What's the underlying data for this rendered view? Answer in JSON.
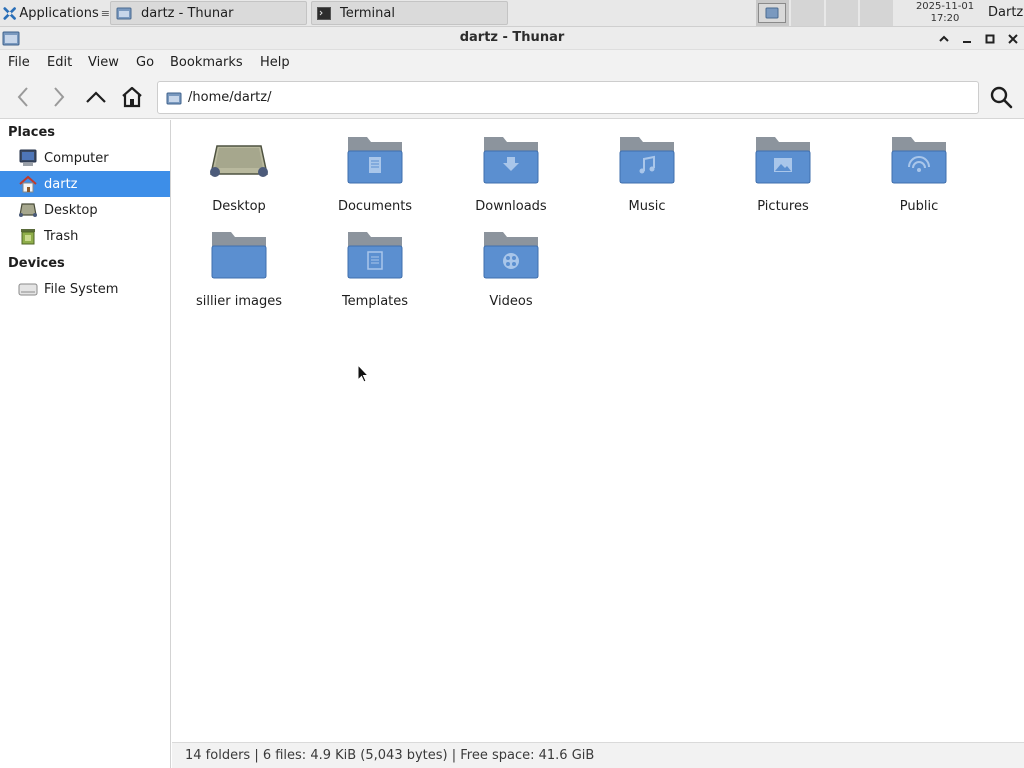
{
  "panel": {
    "applications_label": "Applications",
    "tasks": [
      {
        "label": "dartz - Thunar",
        "icon": "folder-icon"
      },
      {
        "label": "Terminal",
        "icon": "terminal-icon"
      }
    ],
    "clock_date": "2025-11-01",
    "clock_time": "17:20",
    "user": "Dartz"
  },
  "window": {
    "title": "dartz - Thunar"
  },
  "menubar": {
    "file": "File",
    "edit": "Edit",
    "view": "View",
    "go": "Go",
    "bookmarks": "Bookmarks",
    "help": "Help"
  },
  "toolbar": {
    "location": "/home/dartz/"
  },
  "sidebar": {
    "places_header": "Places",
    "devices_header": "Devices",
    "places": [
      {
        "label": "Computer",
        "icon": "computer-icon"
      },
      {
        "label": "dartz",
        "icon": "home-icon",
        "selected": true
      },
      {
        "label": "Desktop",
        "icon": "desktop-icon"
      },
      {
        "label": "Trash",
        "icon": "trash-icon"
      }
    ],
    "devices": [
      {
        "label": "File System",
        "icon": "drive-icon"
      }
    ]
  },
  "files": [
    {
      "label": "Desktop",
      "icon": "desktop-folder-icon"
    },
    {
      "label": "Documents",
      "icon": "documents-folder-icon"
    },
    {
      "label": "Downloads",
      "icon": "downloads-folder-icon"
    },
    {
      "label": "Music",
      "icon": "music-folder-icon"
    },
    {
      "label": "Pictures",
      "icon": "pictures-folder-icon"
    },
    {
      "label": "Public",
      "icon": "public-folder-icon"
    },
    {
      "label": "sillier images",
      "icon": "folder-icon"
    },
    {
      "label": "Templates",
      "icon": "templates-folder-icon"
    },
    {
      "label": "Videos",
      "icon": "videos-folder-icon"
    }
  ],
  "statusbar": {
    "text": "14 folders  |  6 files: 4.9 KiB (5,043 bytes)  |  Free space: 41.6 GiB"
  },
  "colors": {
    "selection": "#3d8ee8",
    "folder_body": "#5b8fd0",
    "folder_back": "#8c949d"
  }
}
